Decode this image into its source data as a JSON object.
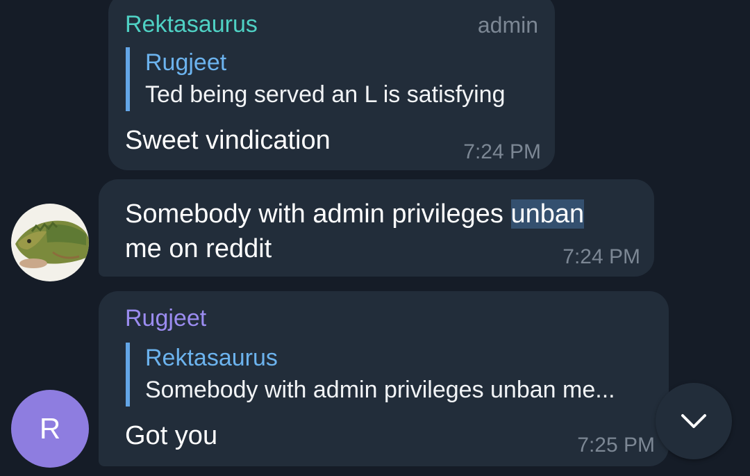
{
  "messages": [
    {
      "sender": "Rektasaurus",
      "sender_color": "#4fd1c4",
      "badge": "admin",
      "reply": {
        "name": "Rugjeet",
        "text": "Ted being served an L is satisfying"
      },
      "text": "Sweet vindication",
      "time": "7:24 PM"
    },
    {
      "text_line1_before": "Somebody with admin privileges ",
      "text_line1_highlight": "unban",
      "text_line2": "me on reddit",
      "time": "7:24 PM",
      "avatar_icon": "iguana-avatar-icon"
    },
    {
      "sender": "Rugjeet",
      "sender_color": "#9b8cf0",
      "reply": {
        "name": "Rektasaurus",
        "text": "Somebody with admin privileges unban me..."
      },
      "text": "Got you",
      "time": "7:25 PM",
      "avatar_letter": "R"
    }
  ],
  "scroll_button": {
    "icon": "chevron-down-icon"
  },
  "colors": {
    "background": "#151c27",
    "bubble": "#222d3a",
    "reply_bar": "#63a5e6",
    "highlight": "#34506f",
    "avatar_r": "#8e7de0"
  }
}
